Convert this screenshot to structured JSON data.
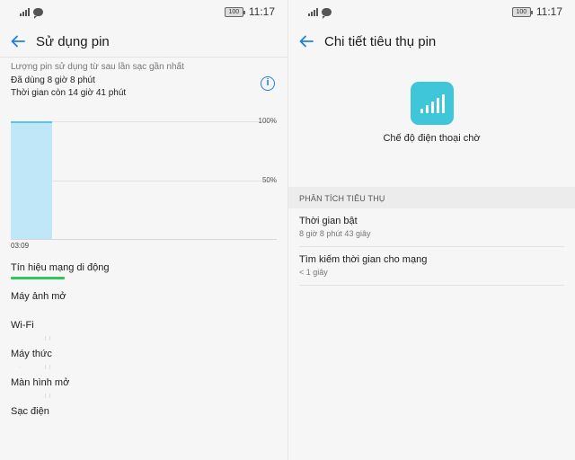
{
  "status_bar": {
    "time": "11:17",
    "battery_level": "100"
  },
  "left_screen": {
    "title": "Sử dụng pin",
    "summary_label": "Lượng pin sử dụng từ sau lần sạc gần nhất",
    "used_time": "Đã dùng 8 giờ 8 phút",
    "remaining_time": "Thời gian còn 14 giờ 41 phút",
    "chart": {
      "y_labels": [
        "100%",
        "50%"
      ],
      "x_label": "03:09"
    },
    "chart_data": {
      "type": "bar",
      "categories": [
        "03:09"
      ],
      "values": [
        100
      ],
      "ylabels": [
        "100%",
        "50%"
      ],
      "ylim": [
        0,
        100
      ]
    },
    "items": [
      {
        "label": "Tín hiệu mạng di động"
      },
      {
        "label": "Máy ảnh mở"
      },
      {
        "label": "Wi-Fi"
      },
      {
        "label": "Máy thức"
      },
      {
        "label": "Màn hình mở"
      },
      {
        "label": "Sạc điện"
      }
    ]
  },
  "right_screen": {
    "title": "Chi tiết tiêu thụ pin",
    "app_name": "Chế độ điện thoại chờ",
    "section_header": "PHÂN TÍCH TIÊU THỤ",
    "details": [
      {
        "title": "Thời gian bật",
        "value": "8 giờ 8 phút 43 giây"
      },
      {
        "title": "Tìm kiếm thời gian cho mạng",
        "value": "< 1 giây"
      }
    ]
  },
  "colors": {
    "accent": "#1e7fe0",
    "chart_fill": "#bfe7f8",
    "chart_line": "#55c6ef",
    "signal_indicator": "#2ec85a",
    "app_tile": "#3fc6d8"
  },
  "icons": [
    "signal-icon",
    "message-icon",
    "battery-icon",
    "back-arrow-icon",
    "info-icon",
    "signal-bars-icon"
  ]
}
